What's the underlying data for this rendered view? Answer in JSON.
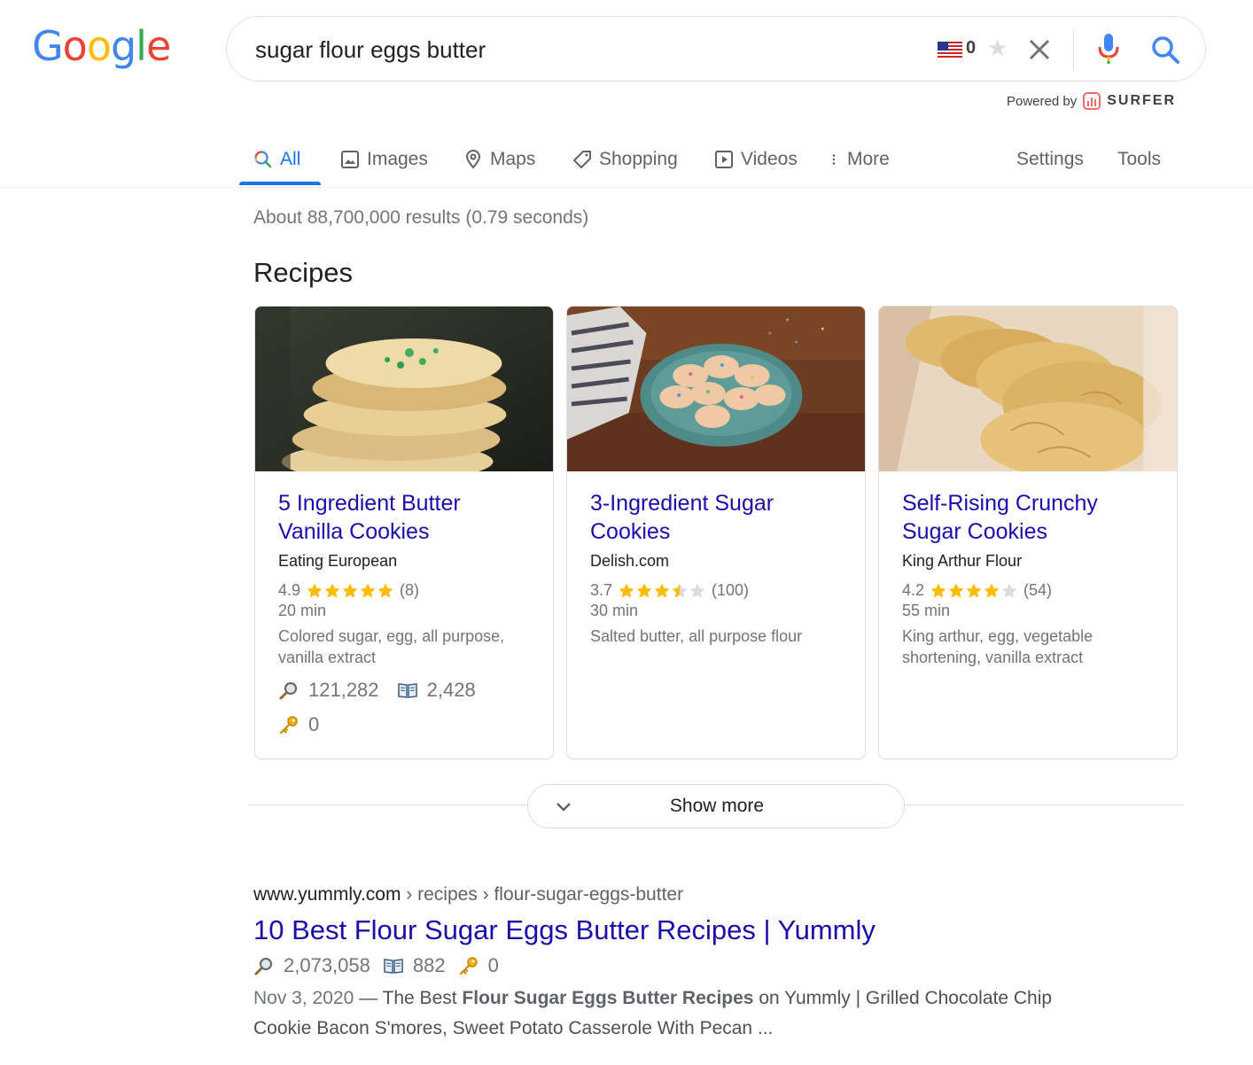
{
  "logo": {
    "letters": [
      "G",
      "o",
      "o",
      "g",
      "l",
      "e"
    ],
    "colors": [
      "#4285F4",
      "#EA4335",
      "#FBBC05",
      "#4285F4",
      "#34A853",
      "#EA4335"
    ]
  },
  "search": {
    "query": "sugar flour eggs butter",
    "flag_count": "0"
  },
  "powered_by": {
    "label": "Powered by",
    "brand": "SURFER"
  },
  "tabs": [
    {
      "label": "All",
      "icon": "search-icon",
      "active": true
    },
    {
      "label": "Images",
      "icon": "image-icon"
    },
    {
      "label": "Maps",
      "icon": "map-pin-icon"
    },
    {
      "label": "Shopping",
      "icon": "tag-icon"
    },
    {
      "label": "Videos",
      "icon": "play-icon"
    },
    {
      "label": "More",
      "icon": "more-vert-icon"
    }
  ],
  "tools": {
    "settings": "Settings",
    "tools": "Tools"
  },
  "result_stats": "About 88,700,000 results (0.79 seconds)",
  "recipes": {
    "heading": "Recipes",
    "cards": [
      {
        "title": "5 Ingredient Butter Vanilla Cookies",
        "source": "Eating European",
        "rating": "4.9",
        "stars": 5,
        "reviews": "(8)",
        "time": "20 min",
        "ingredients": "Colored sugar, egg, all purpose, vanilla extract",
        "searches": "121,282",
        "pages": "2,428",
        "keys": "0"
      },
      {
        "title": "3-Ingredient Sugar Cookies",
        "source": "Delish.com",
        "rating": "3.7",
        "stars": 3.5,
        "reviews": "(100)",
        "time": "30 min",
        "ingredients": "Salted butter, all purpose flour"
      },
      {
        "title": "Self-Rising Crunchy Sugar Cookies",
        "source": "King Arthur Flour",
        "rating": "4.2",
        "stars": 4,
        "reviews": "(54)",
        "time": "55 min",
        "ingredients": "King arthur, egg, vegetable shortening, vanilla extract"
      }
    ],
    "show_more": "Show more"
  },
  "result": {
    "domain": "www.yummly.com",
    "path": " › recipes › flour-sugar-eggs-butter",
    "title": "10 Best Flour Sugar Eggs Butter Recipes | Yummly",
    "searches": "2,073,058",
    "pages": "882",
    "keys": "0",
    "date": "Nov 3, 2020",
    "snippet_pre": " — The Best ",
    "snippet_bold": "Flour Sugar Eggs Butter Recipes",
    "snippet_post": " on Yummly | Grilled Chocolate Chip Cookie Bacon S'mores, Sweet Potato Casserole With Pecan ..."
  },
  "colors": {
    "link": "#1a0dab",
    "accent": "#1a73e8",
    "star": "#fbbc04",
    "star_empty": "#dadce0"
  }
}
